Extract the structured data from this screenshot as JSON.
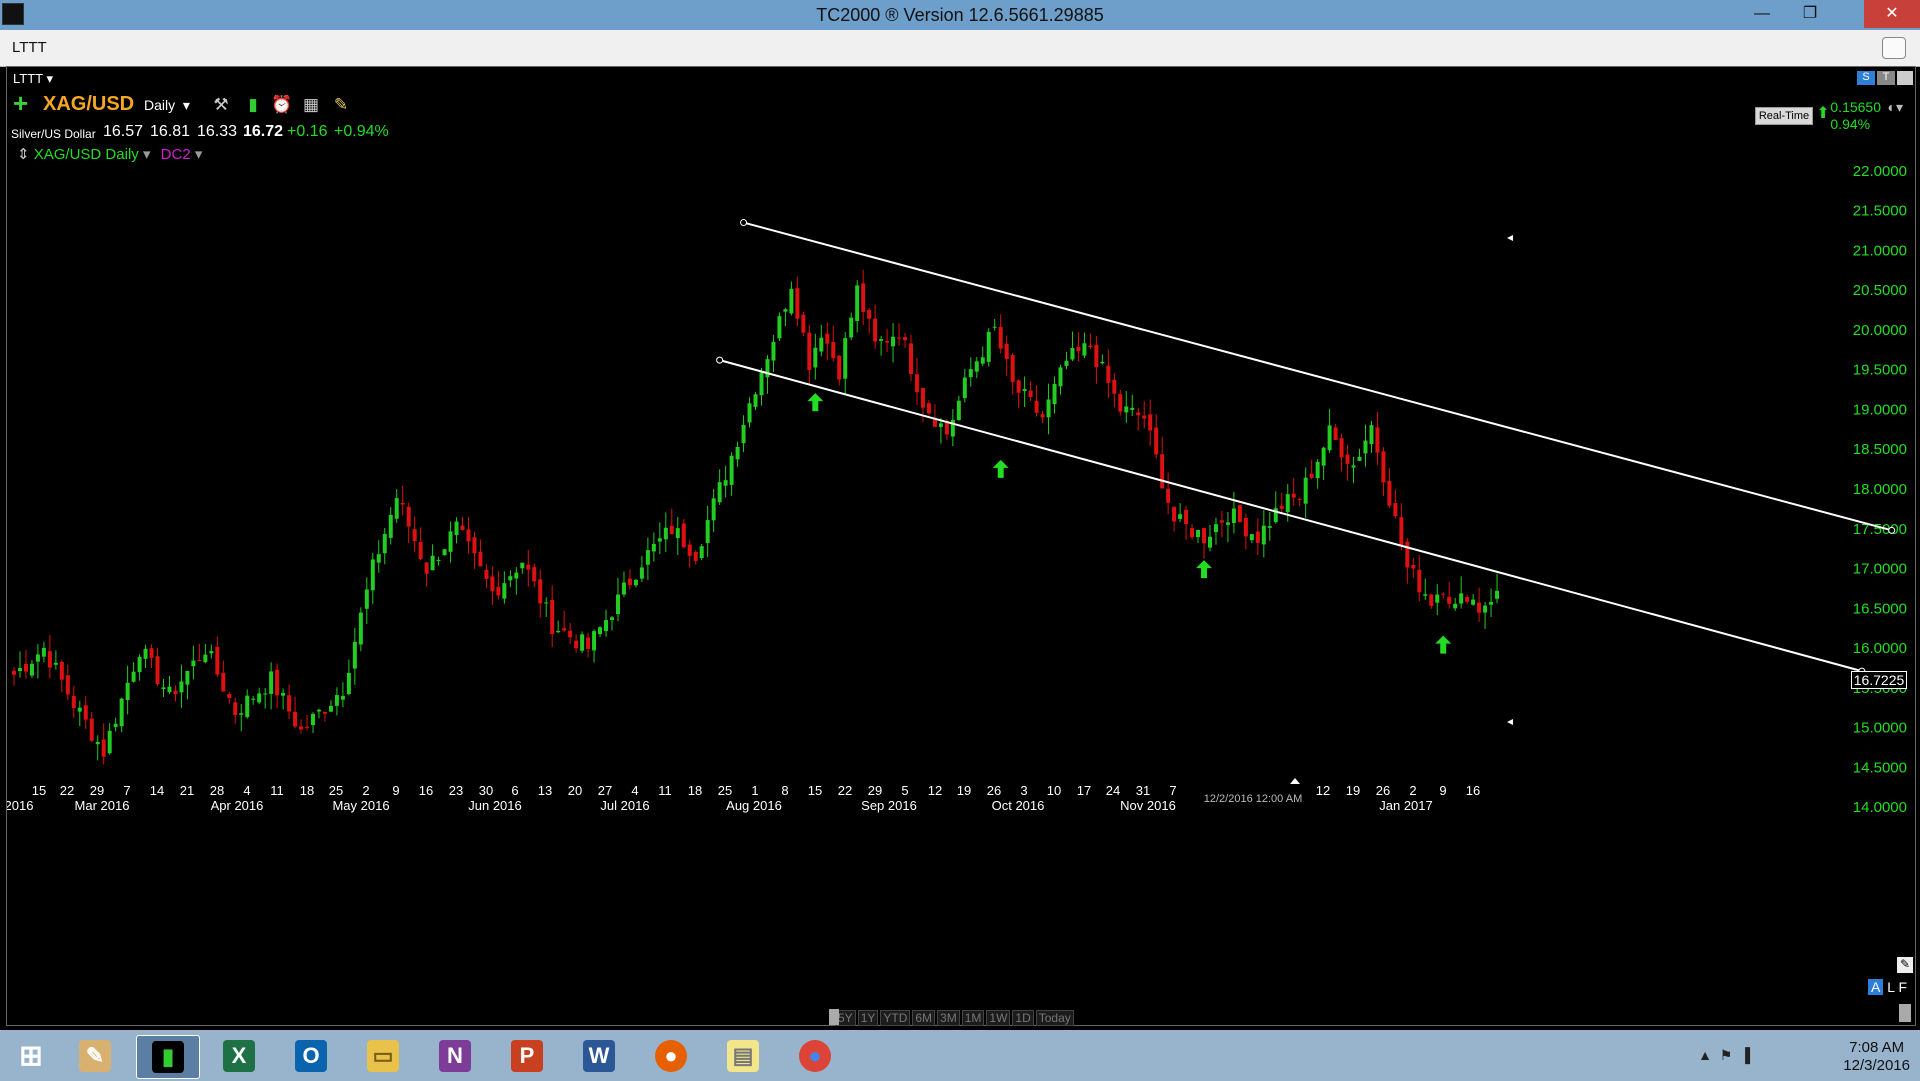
{
  "window": {
    "title": "TC2000 ® Version 12.6.5661.29885"
  },
  "doc_tab": "LTTT",
  "layout_label": "LTTT",
  "chart_header": {
    "symbol": "XAG/USD",
    "period": "Daily",
    "description": "Silver/US Dollar",
    "open": "16.57",
    "high": "16.81",
    "low": "16.33",
    "close": "16.72",
    "change": "+0.16",
    "change_pct": "+0.94%",
    "series_label": "XAG/USD Daily",
    "indicator_label": "DC2",
    "realtime": "Real-Time",
    "rt_change": "0.15650",
    "rt_change_pct": "0.94%",
    "last_price": "16.7225"
  },
  "tool_icons": [
    "settings-tools-icon",
    "chart-style-icon",
    "alarm-clock-icon",
    "watchlist-add-icon",
    "draw-pencil-icon"
  ],
  "chart_data": {
    "type": "candlestick",
    "ylim": [
      13.75,
      22.3
    ],
    "y_ticks": [
      "22.0000",
      "21.5000",
      "21.0000",
      "20.5000",
      "20.0000",
      "19.5000",
      "19.0000",
      "18.5000",
      "18.0000",
      "17.5000",
      "17.0000",
      "16.5000",
      "16.0000",
      "15.5000",
      "15.0000",
      "14.5000",
      "14.0000"
    ],
    "y_tick_values": [
      22.0,
      21.5,
      21.0,
      20.5,
      20.0,
      19.5,
      19.0,
      18.5,
      18.0,
      17.5,
      17.0,
      16.5,
      16.0,
      15.5,
      15.0,
      14.5,
      14.0
    ],
    "x_day_labels": [
      "15",
      "22",
      "29",
      "7",
      "14",
      "21",
      "28",
      "4",
      "11",
      "18",
      "25",
      "2",
      "9",
      "16",
      "23",
      "30",
      "6",
      "13",
      "20",
      "27",
      "4",
      "11",
      "18",
      "25",
      "1",
      "8",
      "15",
      "22",
      "29",
      "5",
      "12",
      "19",
      "26",
      "3",
      "10",
      "17",
      "24",
      "31",
      "7",
      "12",
      "19",
      "26",
      "2",
      "9",
      "16"
    ],
    "x_month_labels": [
      "2016",
      "Mar 2016",
      "Apr 2016",
      "May 2016",
      "Jun 2016",
      "Jul 2016",
      "Aug 2016",
      "Sep 2016",
      "Oct 2016",
      "Nov 2016",
      "Jan 2017"
    ],
    "cursor_label": "12/2/2016 12:00 AM",
    "segments": [
      [
        15.6,
        16.0
      ],
      [
        16.0,
        15.3
      ],
      [
        15.3,
        14.7
      ],
      [
        14.7,
        16.0
      ],
      [
        16.0,
        15.4
      ],
      [
        15.4,
        16.0
      ],
      [
        16.0,
        15.2
      ],
      [
        15.2,
        15.6
      ],
      [
        15.6,
        14.95
      ],
      [
        14.95,
        15.5
      ],
      [
        15.5,
        17.0
      ],
      [
        17.0,
        17.9
      ],
      [
        17.9,
        17.0
      ],
      [
        17.0,
        17.5
      ],
      [
        17.5,
        16.7
      ],
      [
        16.7,
        17.1
      ],
      [
        17.1,
        16.3
      ],
      [
        16.3,
        16.0
      ],
      [
        16.0,
        16.6
      ],
      [
        16.6,
        17.1
      ],
      [
        17.1,
        17.5
      ],
      [
        17.5,
        17.2
      ],
      [
        17.2,
        18.2
      ],
      [
        18.2,
        19.3
      ],
      [
        19.3,
        20.1
      ],
      [
        20.1,
        20.6
      ],
      [
        20.6,
        19.6
      ],
      [
        19.6,
        20.0
      ],
      [
        20.0,
        19.5
      ],
      [
        19.5,
        20.5
      ],
      [
        20.5,
        19.8
      ],
      [
        19.8,
        20.0
      ],
      [
        20.0,
        19.1
      ],
      [
        19.1,
        18.7
      ],
      [
        18.7,
        19.5
      ],
      [
        19.5,
        20.0
      ],
      [
        20.0,
        19.3
      ],
      [
        19.3,
        18.9
      ],
      [
        18.9,
        19.6
      ],
      [
        19.6,
        19.8
      ],
      [
        19.8,
        19.0
      ],
      [
        19.0,
        18.9
      ],
      [
        18.9,
        17.6
      ],
      [
        17.6,
        17.4
      ],
      [
        17.4,
        17.7
      ],
      [
        17.7,
        17.4
      ],
      [
        17.4,
        17.8
      ],
      [
        17.8,
        17.9
      ],
      [
        17.9,
        18.7
      ],
      [
        18.7,
        18.3
      ],
      [
        18.3,
        18.8
      ],
      [
        18.8,
        17.0
      ],
      [
        17.0,
        16.6
      ],
      [
        16.6,
        16.8
      ],
      [
        16.8,
        16.5
      ],
      [
        16.5,
        16.7
      ],
      [
        16.7,
        16.5
      ],
      [
        16.5,
        16.72
      ]
    ],
    "segment_counts": [
      6,
      5,
      5,
      6,
      5,
      6,
      5,
      6,
      5,
      7,
      5,
      4,
      5,
      5,
      6,
      5,
      5,
      6,
      5,
      4,
      5,
      4,
      5,
      5,
      4,
      2,
      3,
      2,
      3,
      3,
      3,
      4,
      4,
      4,
      4,
      4,
      3,
      5,
      4,
      4,
      5,
      4,
      5,
      5,
      4,
      5,
      4,
      3,
      5,
      4,
      3,
      6,
      4,
      2,
      2,
      2,
      2,
      3
    ],
    "trendlines": [
      {
        "from": {
          "bar": 122,
          "price": 21.35
        },
        "to": {
          "bar": 314,
          "price": 17.48
        }
      },
      {
        "from": {
          "bar": 118,
          "price": 19.62
        },
        "to": {
          "bar": 309,
          "price": 15.71
        }
      }
    ],
    "signal_arrows": [
      {
        "bar": 134,
        "price": 19.08
      },
      {
        "bar": 165,
        "price": 18.24
      },
      {
        "bar": 199,
        "price": 16.98
      },
      {
        "bar": 239,
        "price": 16.03
      }
    ]
  },
  "range_buttons": [
    "5Y",
    "1Y",
    "YTD",
    "6M",
    "3M",
    "1M",
    "1W",
    "1D",
    "Today"
  ],
  "alf": {
    "a": "A",
    "l": "L",
    "f": "F"
  },
  "taskbar": {
    "apps": [
      "windows-start-icon",
      "paint-icon",
      "tc2000-icon",
      "excel-icon",
      "outlook-icon",
      "file-explorer-icon",
      "onenote-icon",
      "powerpoint-icon",
      "word-icon",
      "firefox-icon",
      "sticky-notes-icon",
      "chrome-icon"
    ],
    "time": "7:08 AM",
    "date": "12/3/2016"
  },
  "colors": {
    "up": "#22cc22",
    "down": "#dd1111",
    "trendline": "#ffffff",
    "axis_text": "#22dd22",
    "arrow": "#22dd22"
  }
}
